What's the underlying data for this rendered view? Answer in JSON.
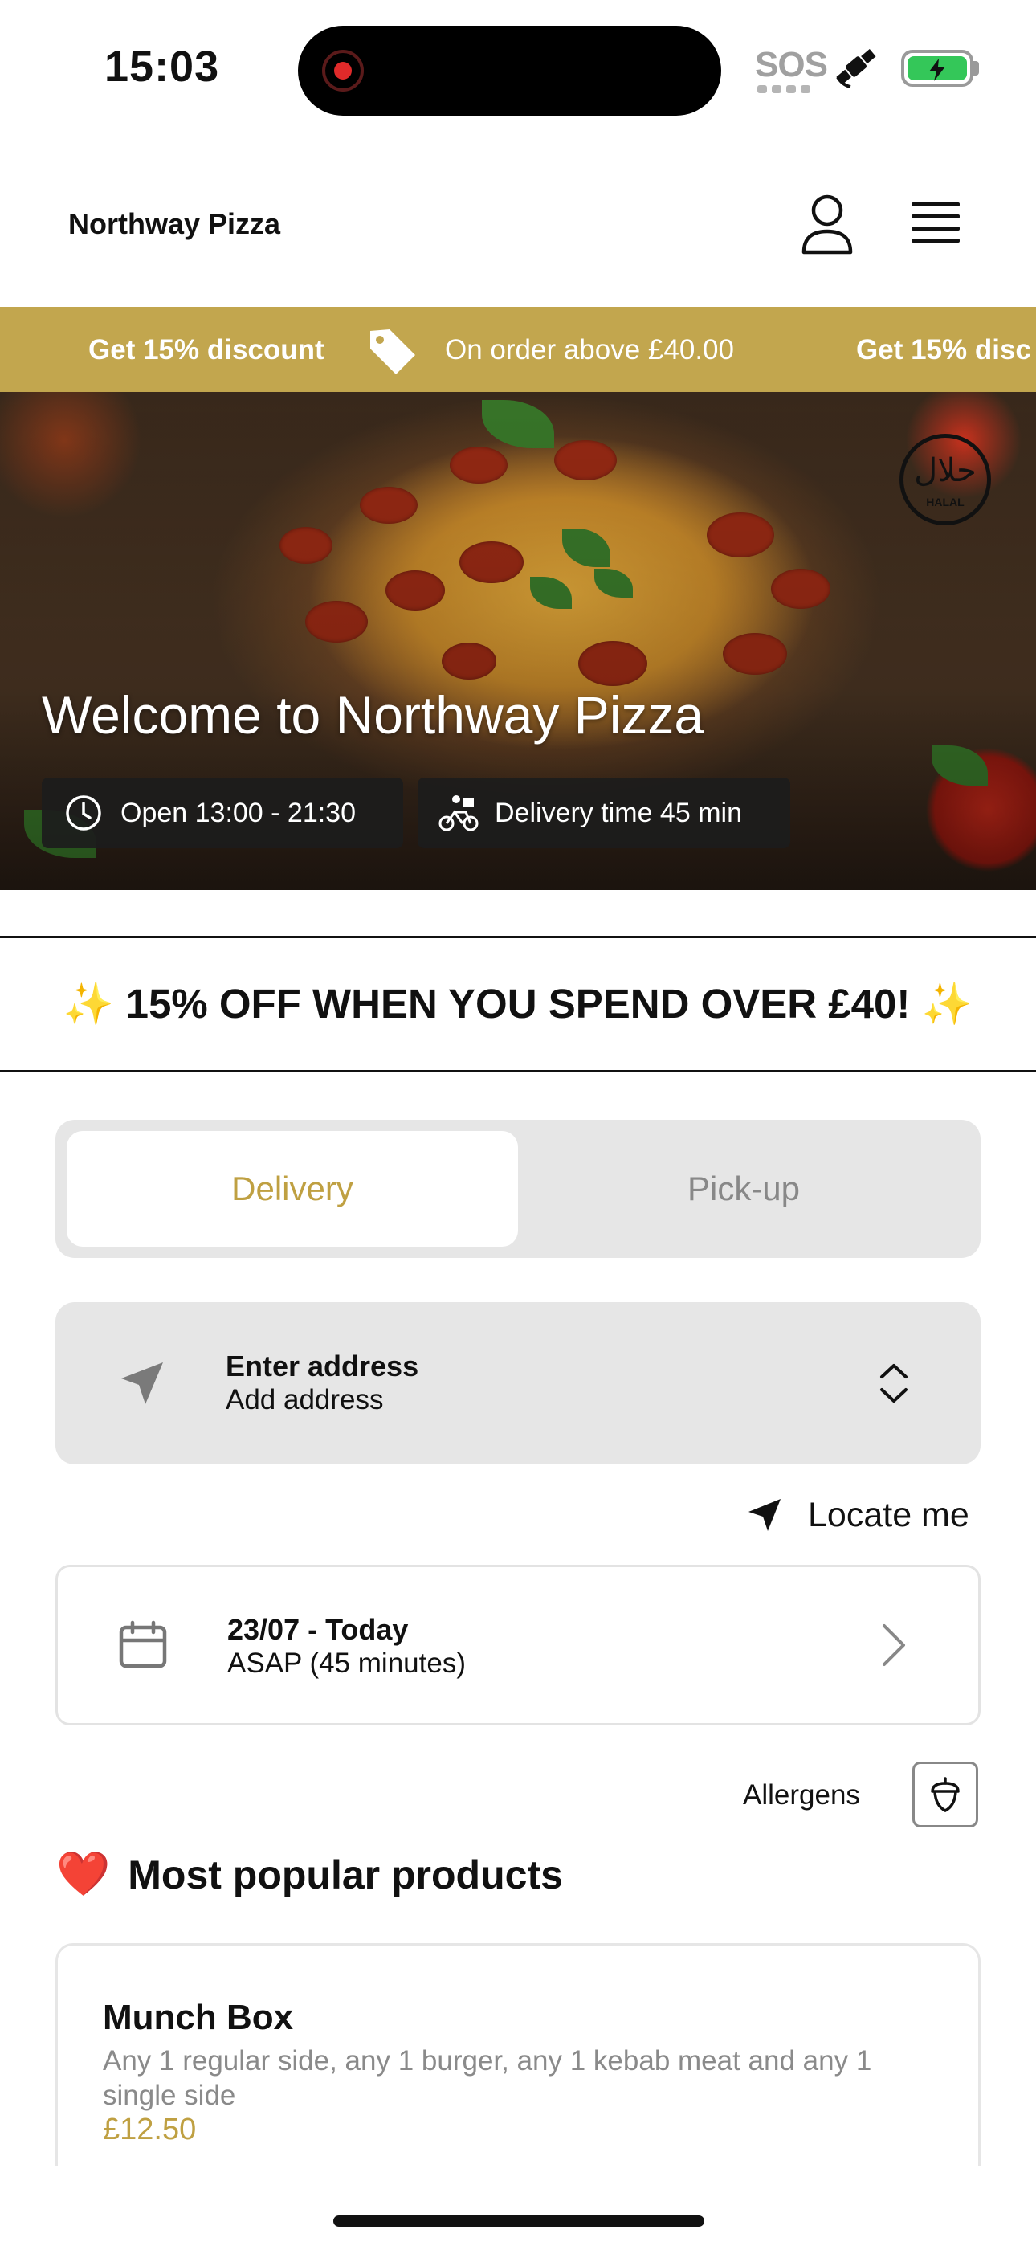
{
  "status_bar": {
    "time": "15:03",
    "sos": "SOS",
    "icons": [
      "screen-record-icon",
      "satellite-icon",
      "battery-charging-icon"
    ]
  },
  "header": {
    "brand": "Northway Pizza",
    "icons": [
      "user-icon",
      "hamburger-menu-icon"
    ]
  },
  "ribbon": {
    "discount": "Get 15% discount",
    "condition": "On order above £40.00",
    "discount_repeat": "Get 15% disc",
    "accent": "#c2a64e"
  },
  "hero": {
    "title": "Welcome to Northway Pizza",
    "hours": "Open 13:00 - 21:30",
    "delivery_time": "Delivery time 45 min",
    "badge_label": "HALAL",
    "badge_arabic": "حلال"
  },
  "announcement": {
    "text": "✨ 15% OFF WHEN YOU SPEND OVER £40! ✨"
  },
  "order_mode": {
    "tabs": [
      "Delivery",
      "Pick-up"
    ],
    "selected": "Delivery",
    "active_color": "#bfa042"
  },
  "address": {
    "title": "Enter address",
    "subtitle": "Add address"
  },
  "locate": {
    "label": "Locate me"
  },
  "schedule": {
    "title": "23/07 - Today",
    "subtitle": "ASAP (45 minutes)"
  },
  "allergens": {
    "label": "Allergens"
  },
  "popular": {
    "title": "Most popular products",
    "emoji": "❤️"
  },
  "products": [
    {
      "name": "Munch Box",
      "description": "Any 1 regular side, any 1 burger, any 1 kebab meat and any 1 single side",
      "price": "£12.50"
    }
  ]
}
